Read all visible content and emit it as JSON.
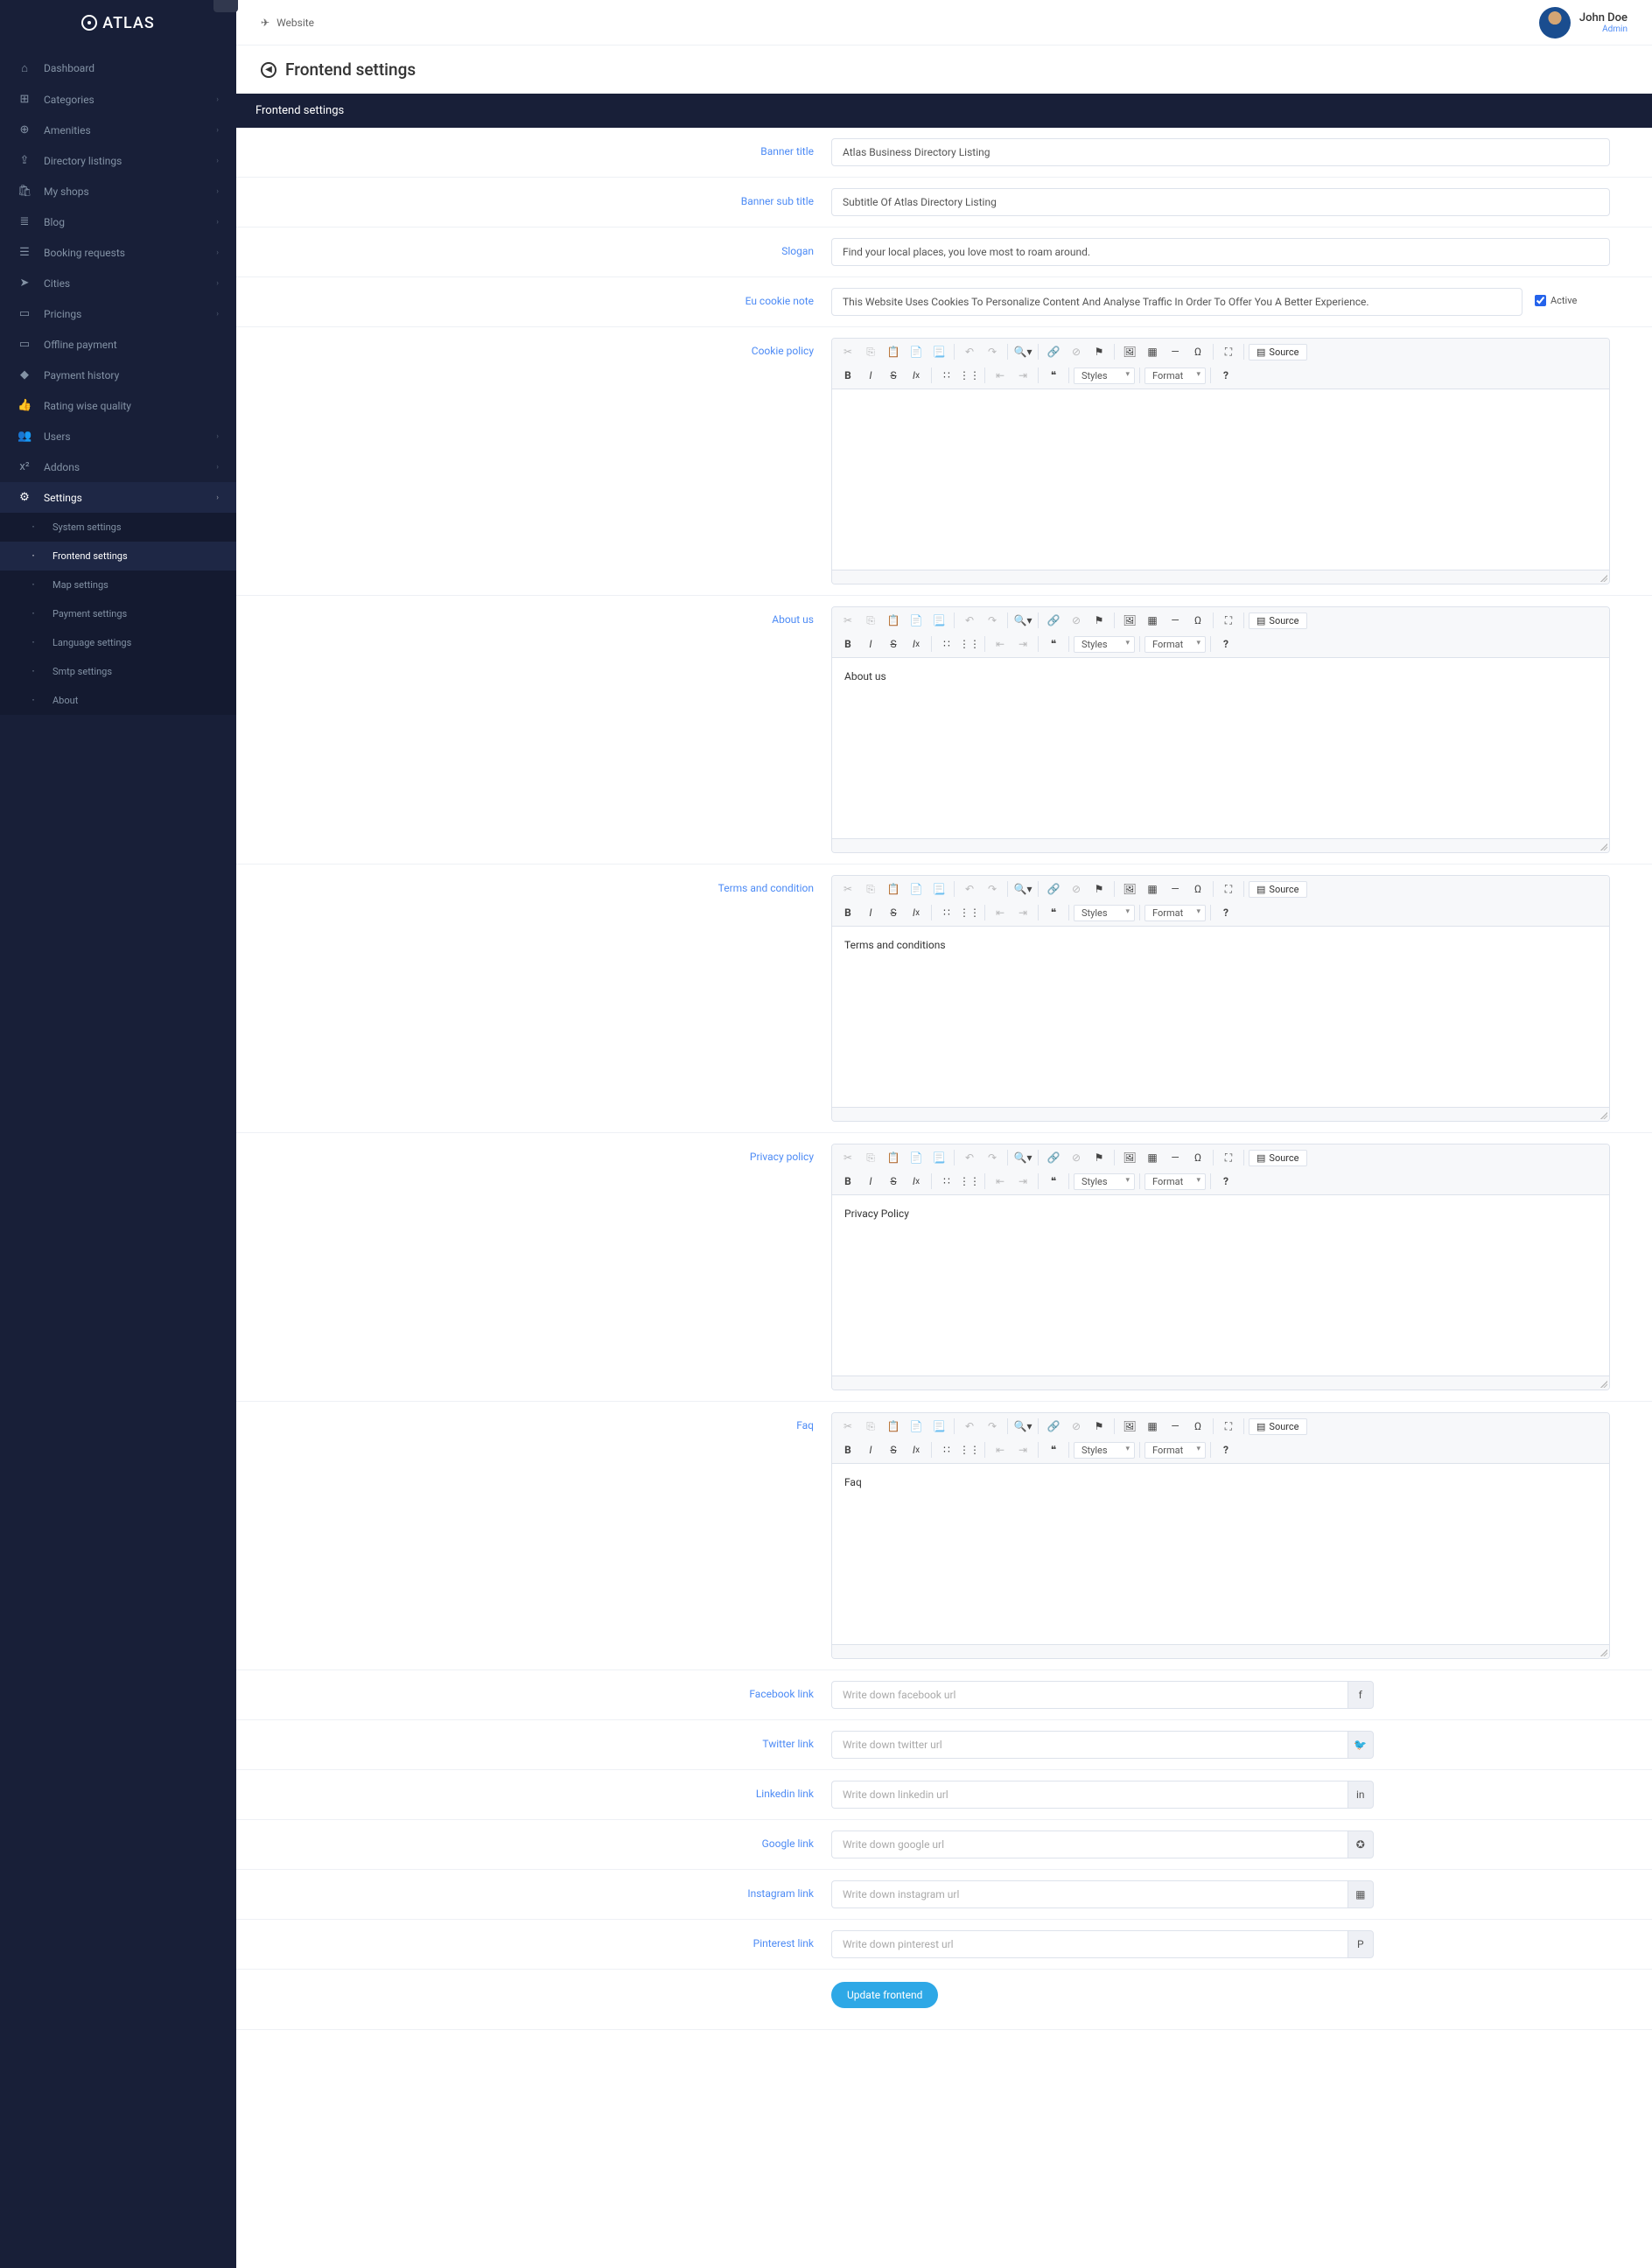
{
  "brand": "ATLAS",
  "topbar": {
    "breadcrumb": "Website"
  },
  "user": {
    "name": "John Doe",
    "role": "Admin"
  },
  "page": {
    "title": "Frontend settings",
    "panel_title": "Frontend settings"
  },
  "sidebar": {
    "items": [
      {
        "label": "Dashboard",
        "icon": "⌂",
        "chev": false
      },
      {
        "label": "Categories",
        "icon": "⊞",
        "chev": true
      },
      {
        "label": "Amenities",
        "icon": "⊕",
        "chev": true
      },
      {
        "label": "Directory listings",
        "icon": "⇪",
        "chev": true
      },
      {
        "label": "My shops",
        "icon": "🛍",
        "chev": true
      },
      {
        "label": "Blog",
        "icon": "≣",
        "chev": true
      },
      {
        "label": "Booking requests",
        "icon": "☰",
        "chev": true
      },
      {
        "label": "Cities",
        "icon": "➤",
        "chev": true
      },
      {
        "label": "Pricings",
        "icon": "▭",
        "chev": true
      },
      {
        "label": "Offline payment",
        "icon": "▭",
        "chev": false
      },
      {
        "label": "Payment history",
        "icon": "◆",
        "chev": false
      },
      {
        "label": "Rating wise quality",
        "icon": "👍",
        "chev": false
      },
      {
        "label": "Users",
        "icon": "👥",
        "chev": true
      },
      {
        "label": "Addons",
        "icon": "x²",
        "chev": true
      },
      {
        "label": "Settings",
        "icon": "⚙",
        "chev": true
      }
    ],
    "submenu": [
      {
        "label": "System settings"
      },
      {
        "label": "Frontend settings"
      },
      {
        "label": "Map settings"
      },
      {
        "label": "Payment settings"
      },
      {
        "label": "Language settings"
      },
      {
        "label": "Smtp settings"
      },
      {
        "label": "About"
      }
    ]
  },
  "form": {
    "banner_title": {
      "label": "Banner title",
      "value": "Atlas Business Directory Listing"
    },
    "banner_subtitle": {
      "label": "Banner sub title",
      "value": "Subtitle Of Atlas Directory Listing"
    },
    "slogan": {
      "label": "Slogan",
      "value": "Find your local places, you love most to roam around."
    },
    "cookie_note": {
      "label": "Eu cookie note",
      "value": "This Website Uses Cookies To Personalize Content And Analyse Traffic In Order To Offer You A Better Experience.",
      "active_label": "Active"
    },
    "cookie_policy": {
      "label": "Cookie policy",
      "value": ""
    },
    "about_us": {
      "label": "About us",
      "value": "About us"
    },
    "terms": {
      "label": "Terms and condition",
      "value": "Terms and conditions"
    },
    "privacy": {
      "label": "Privacy policy",
      "value": "Privacy Policy"
    },
    "faq": {
      "label": "Faq",
      "value": "Faq"
    },
    "facebook": {
      "label": "Facebook link",
      "placeholder": "Write down facebook url"
    },
    "twitter": {
      "label": "Twitter link",
      "placeholder": "Write down twitter url"
    },
    "linkedin": {
      "label": "Linkedin link",
      "placeholder": "Write down linkedin url"
    },
    "google": {
      "label": "Google link",
      "placeholder": "Write down google url"
    },
    "instagram": {
      "label": "Instagram link",
      "placeholder": "Write down instagram url"
    },
    "pinterest": {
      "label": "Pinterest link",
      "placeholder": "Write down pinterest url"
    },
    "submit": "Update frontend"
  },
  "editor": {
    "styles": "Styles",
    "format": "Format",
    "source": "Source"
  }
}
